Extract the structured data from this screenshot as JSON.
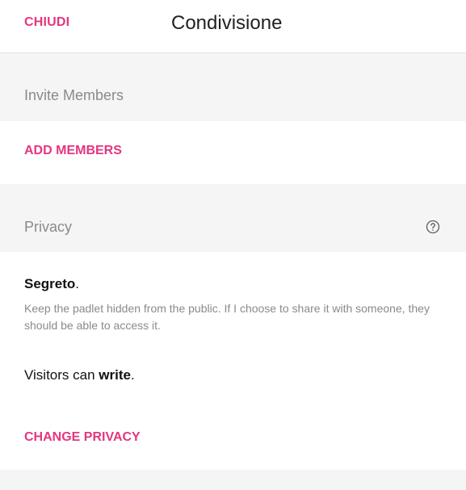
{
  "header": {
    "close_label": "CHIUDI",
    "title": "Condivisione"
  },
  "invite": {
    "label": "Invite Members",
    "action_label": "ADD MEMBERS"
  },
  "privacy": {
    "label": "Privacy",
    "help_icon": "question-circle-icon",
    "setting_name": "Segreto",
    "setting_suffix": ".",
    "description": "Keep the padlet hidden from the public. If I choose to share it with someone, they should be able to access it.",
    "visitors_prefix": "Visitors can ",
    "visitors_permission": "write",
    "visitors_suffix": ".",
    "action_label": "CHANGE PRIVACY"
  },
  "colors": {
    "accent": "#e5367f",
    "section_bg": "#f5f5f5",
    "muted_text": "#8a8a8a"
  }
}
